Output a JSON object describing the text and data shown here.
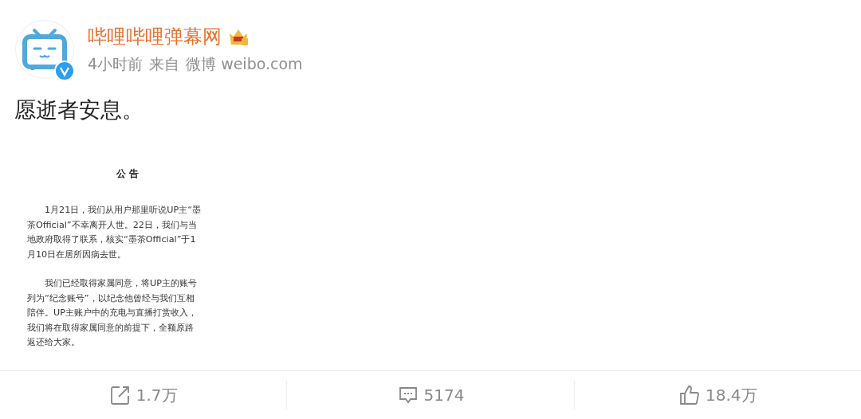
{
  "author": {
    "name": "哔哩哔哩弹幕网",
    "verified": true,
    "time": "4小时前",
    "source_prefix": "来自",
    "source": "微博 weibo.com"
  },
  "text": "愿逝者安息。",
  "notice": {
    "title": "公 告",
    "paragraphs": [
      [
        "1月21日，我们从用户那里听说UP主“墨",
        "茶Official”不幸离开人世。22日，我们与当",
        "地政府取得了联系，核实“墨茶Official”于1",
        "月10日在居所因病去世。"
      ],
      [
        "我们已经取得家属同意，将UP主的账号",
        "列为“纪念账号”，以纪念他曾经与我们互相",
        "陪伴。UP主账户中的充电与直播打赏收入，",
        "我们将在取得家属同意的前提下，全额原路",
        "返还给大家。"
      ]
    ]
  },
  "actions": [
    {
      "kind": "repost",
      "count": "1.7万"
    },
    {
      "kind": "comment",
      "count": "5174"
    },
    {
      "kind": "like",
      "count": "18.4万"
    }
  ]
}
